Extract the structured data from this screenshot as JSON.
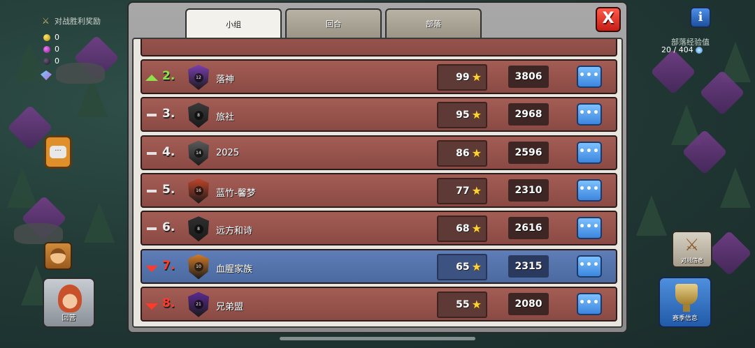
{
  "hud_left": {
    "win_reward_label": "对战胜利奖励",
    "resources": [
      {
        "type": "gold",
        "value": "0"
      },
      {
        "type": "elixir",
        "value": "0"
      },
      {
        "type": "dark_elixir",
        "value": "0"
      }
    ],
    "home_label": "回营"
  },
  "hud_right": {
    "clan_xp_label": "部落经验值",
    "clan_xp_value": "20 / 404",
    "war_info_label": "对战信息",
    "season_info_label": "赛季信息"
  },
  "tabs": [
    {
      "label": "小组",
      "active": true
    },
    {
      "label": "回合",
      "active": false
    },
    {
      "label": "部落",
      "active": false
    }
  ],
  "close_label": "X",
  "more_label": "•••",
  "rows": [
    {
      "trend": "up",
      "rank": "2.",
      "badge_level": "12",
      "badge_color": "#7a3fb0",
      "name": "落神",
      "stars": "99",
      "points": "3806",
      "mine": false
    },
    {
      "trend": "same",
      "rank": "3.",
      "badge_level": "8",
      "badge_color": "#3a3a3a",
      "name": "旅社",
      "stars": "95",
      "points": "2968",
      "mine": false
    },
    {
      "trend": "same",
      "rank": "4.",
      "badge_level": "14",
      "badge_color": "#5a5a5a",
      "name": "2025",
      "stars": "86",
      "points": "2596",
      "mine": false
    },
    {
      "trend": "same",
      "rank": "5.",
      "badge_level": "16",
      "badge_color": "#c0452a",
      "name": "蓝竹-馨梦",
      "stars": "77",
      "points": "2310",
      "mine": false
    },
    {
      "trend": "same",
      "rank": "6.",
      "badge_level": "8",
      "badge_color": "#2f2f2f",
      "name": "远方和诗",
      "stars": "68",
      "points": "2616",
      "mine": false
    },
    {
      "trend": "down",
      "rank": "7.",
      "badge_level": "10",
      "badge_color": "#d07a2a",
      "name": "血腥家族",
      "stars": "65",
      "points": "2315",
      "mine": true
    },
    {
      "trend": "down",
      "rank": "8.",
      "badge_level": "21",
      "badge_color": "#5a2a90",
      "name": "兄弟盟",
      "stars": "55",
      "points": "2080",
      "mine": false
    }
  ]
}
